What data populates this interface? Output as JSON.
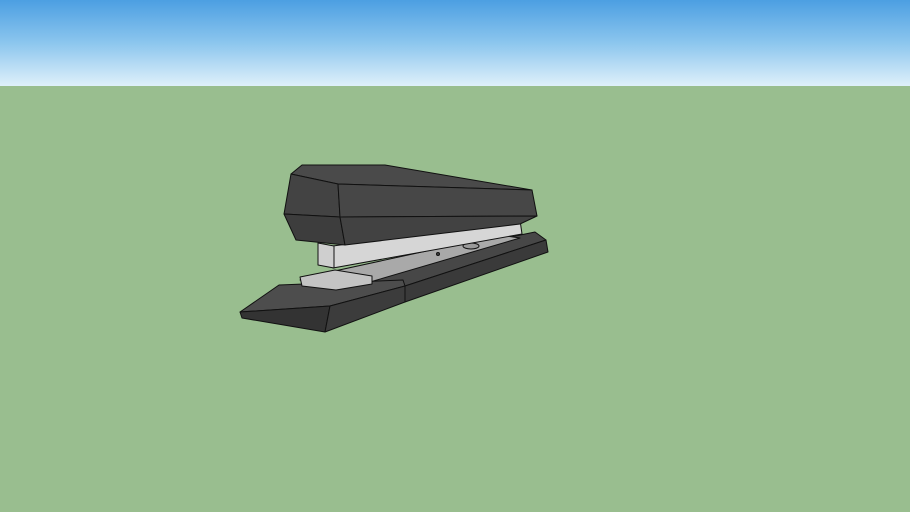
{
  "scene": {
    "subject": "stapler",
    "colors": {
      "sky_top": "#4c9fe2",
      "sky_bottom": "#dff0fa",
      "ground": "#99be8f",
      "body_dark": "#3f3f3f",
      "body_mid": "#4a4a4a",
      "metal_light": "#d2d2d2",
      "metal_mid": "#a8a8a8"
    }
  }
}
